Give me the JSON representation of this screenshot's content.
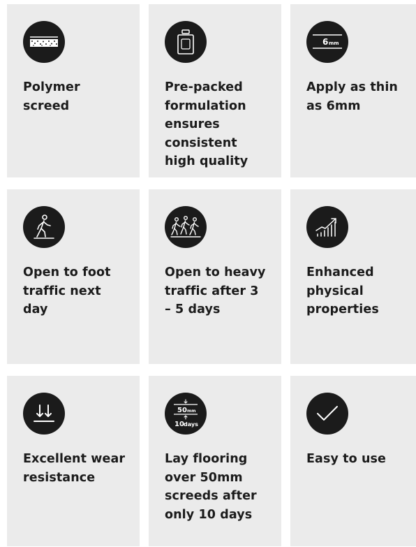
{
  "features": [
    {
      "label": "Polymer screed",
      "icon": "screed-layer-icon"
    },
    {
      "label": "Pre-packed formulation ensures consistent high quality",
      "icon": "container-icon"
    },
    {
      "label": "Apply as thin as 6mm",
      "icon": "thickness-6mm-icon",
      "icon_text": "6",
      "icon_unit": "mm"
    },
    {
      "label": "Open to foot traffic next day",
      "icon": "walking-person-icon"
    },
    {
      "label": "Open to heavy traffic after 3 – 5 days",
      "icon": "group-walking-icon"
    },
    {
      "label": "Enhanced physical properties",
      "icon": "growth-chart-icon"
    },
    {
      "label": "Excellent wear resistance",
      "icon": "down-arrows-icon"
    },
    {
      "label": "Lay flooring over 50mm screeds after only 10 days",
      "icon": "screed-50mm-10days-icon",
      "icon_top": "50",
      "icon_top_unit": "mm",
      "icon_bottom": "10",
      "icon_bottom_unit": "days"
    },
    {
      "label": "Easy to use",
      "icon": "check-icon"
    }
  ],
  "colors": {
    "card_background": "#ebebeb",
    "icon_background": "#1b1b1b",
    "text": "#1b1b1b",
    "icon_foreground": "#ffffff"
  }
}
